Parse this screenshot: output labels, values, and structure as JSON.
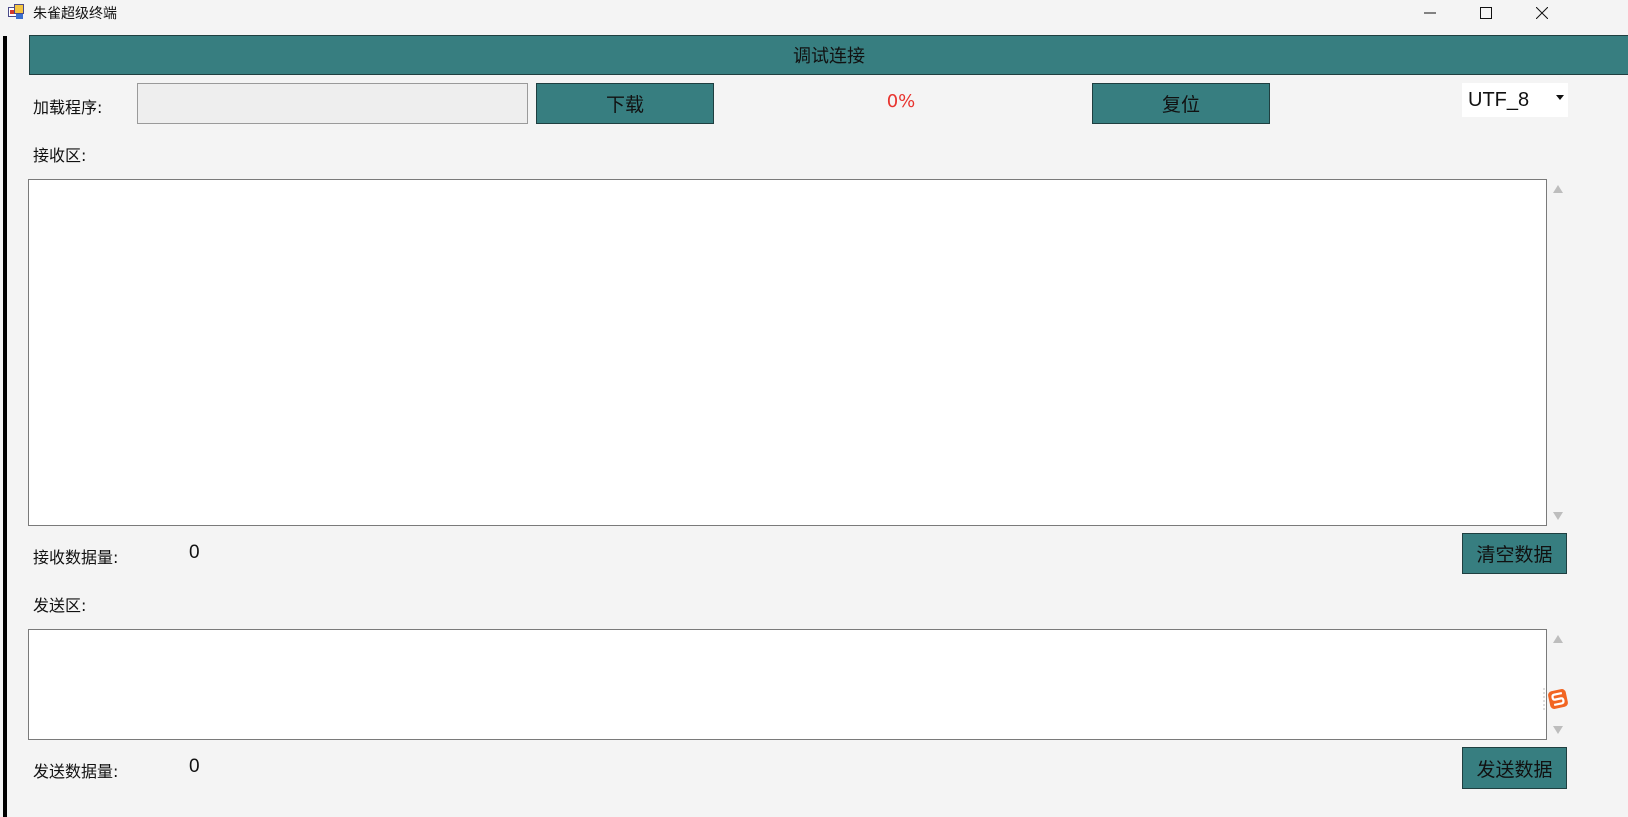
{
  "window": {
    "title": "朱雀超级终端",
    "controls": [
      "minimize-icon",
      "maximize-icon",
      "close-icon"
    ]
  },
  "toolbar": {
    "connect_label": "调试连接",
    "load_program_label": "加载程序:",
    "load_program_value": "",
    "download_label": "下载",
    "progress": "0%",
    "reset_label": "复位",
    "encoding": "UTF_8"
  },
  "receive": {
    "label": "接收区:",
    "content": "",
    "count_label": "接收数据量:",
    "count": "0",
    "clear_label": "清空数据"
  },
  "send": {
    "label": "发送区:",
    "content": "",
    "count_label": "发送数据量:",
    "count": "0",
    "send_label": "发送数据"
  },
  "colors": {
    "accent": "#377e80",
    "progress_text": "#e8332e",
    "background": "#f4f4f4"
  }
}
